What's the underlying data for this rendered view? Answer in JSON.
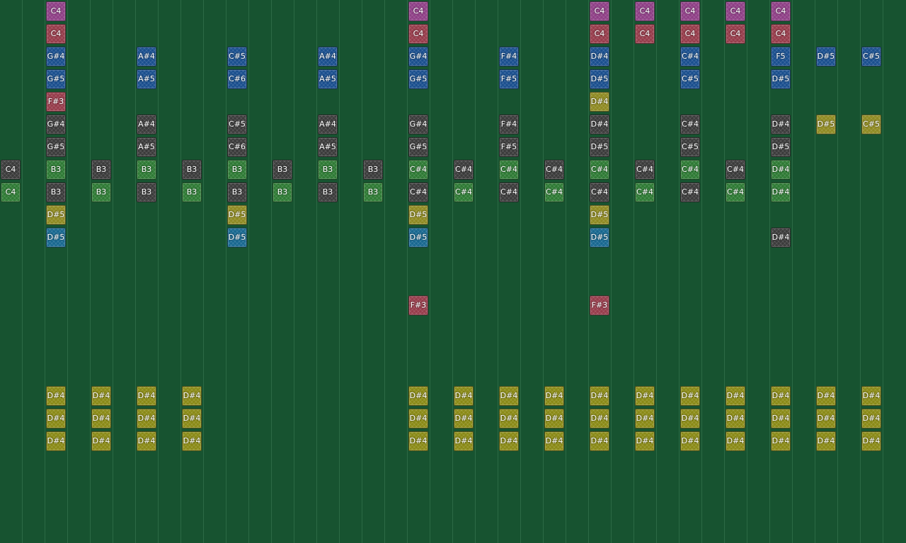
{
  "colors": {
    "background": "#175330",
    "gridline": "#2c6a45",
    "purple": "#8e3f86",
    "red": "#963c4b",
    "blue": "#1a4f8e",
    "gray": "#3b3b3b",
    "green": "#2e7a34",
    "olive": "#8f8a22",
    "yellow": "#8a8a16",
    "teal": "#186890"
  },
  "columns": [
    [
      {
        "row": 7,
        "label": "C4",
        "color": "gray"
      },
      {
        "row": 8,
        "label": "C4",
        "color": "green"
      }
    ],
    [
      {
        "row": 0,
        "label": "C4",
        "color": "purple"
      },
      {
        "row": 1,
        "label": "C4",
        "color": "red"
      },
      {
        "row": 2,
        "label": "G#4",
        "color": "blue"
      },
      {
        "row": 3,
        "label": "G#5",
        "color": "blue"
      },
      {
        "row": 4,
        "label": "F#3",
        "color": "red"
      },
      {
        "row": 5,
        "label": "G#4",
        "color": "gray"
      },
      {
        "row": 6,
        "label": "G#5",
        "color": "gray"
      },
      {
        "row": 7,
        "label": "B3",
        "color": "green"
      },
      {
        "row": 8,
        "label": "B3",
        "color": "gray"
      },
      {
        "row": 9,
        "label": "D#5",
        "color": "olive"
      },
      {
        "row": 10,
        "label": "D#5",
        "color": "teal"
      },
      {
        "row": 17,
        "label": "D#4",
        "color": "yellow"
      },
      {
        "row": 18,
        "label": "D#4",
        "color": "yellow"
      },
      {
        "row": 19,
        "label": "D#4",
        "color": "yellow"
      }
    ],
    [
      {
        "row": 7,
        "label": "B3",
        "color": "gray"
      },
      {
        "row": 8,
        "label": "B3",
        "color": "green"
      },
      {
        "row": 17,
        "label": "D#4",
        "color": "yellow"
      },
      {
        "row": 18,
        "label": "D#4",
        "color": "yellow"
      },
      {
        "row": 19,
        "label": "D#4",
        "color": "yellow"
      }
    ],
    [
      {
        "row": 2,
        "label": "A#4",
        "color": "blue"
      },
      {
        "row": 3,
        "label": "A#5",
        "color": "blue"
      },
      {
        "row": 5,
        "label": "A#4",
        "color": "gray"
      },
      {
        "row": 6,
        "label": "A#5",
        "color": "gray"
      },
      {
        "row": 7,
        "label": "B3",
        "color": "green"
      },
      {
        "row": 8,
        "label": "B3",
        "color": "gray"
      },
      {
        "row": 17,
        "label": "D#4",
        "color": "yellow"
      },
      {
        "row": 18,
        "label": "D#4",
        "color": "yellow"
      },
      {
        "row": 19,
        "label": "D#4",
        "color": "yellow"
      }
    ],
    [
      {
        "row": 7,
        "label": "B3",
        "color": "gray"
      },
      {
        "row": 8,
        "label": "B3",
        "color": "green"
      },
      {
        "row": 17,
        "label": "D#4",
        "color": "yellow"
      },
      {
        "row": 18,
        "label": "D#4",
        "color": "yellow"
      },
      {
        "row": 19,
        "label": "D#4",
        "color": "yellow"
      }
    ],
    [
      {
        "row": 2,
        "label": "C#5",
        "color": "blue"
      },
      {
        "row": 3,
        "label": "C#6",
        "color": "blue"
      },
      {
        "row": 5,
        "label": "C#5",
        "color": "gray"
      },
      {
        "row": 6,
        "label": "C#6",
        "color": "gray"
      },
      {
        "row": 7,
        "label": "B3",
        "color": "green"
      },
      {
        "row": 8,
        "label": "B3",
        "color": "gray"
      },
      {
        "row": 9,
        "label": "D#5",
        "color": "olive"
      },
      {
        "row": 10,
        "label": "D#5",
        "color": "teal"
      }
    ],
    [
      {
        "row": 7,
        "label": "B3",
        "color": "gray"
      },
      {
        "row": 8,
        "label": "B3",
        "color": "green"
      }
    ],
    [
      {
        "row": 2,
        "label": "A#4",
        "color": "blue"
      },
      {
        "row": 3,
        "label": "A#5",
        "color": "blue"
      },
      {
        "row": 5,
        "label": "A#4",
        "color": "gray"
      },
      {
        "row": 6,
        "label": "A#5",
        "color": "gray"
      },
      {
        "row": 7,
        "label": "B3",
        "color": "green"
      },
      {
        "row": 8,
        "label": "B3",
        "color": "gray"
      }
    ],
    [
      {
        "row": 7,
        "label": "B3",
        "color": "gray"
      },
      {
        "row": 8,
        "label": "B3",
        "color": "green"
      }
    ],
    [
      {
        "row": 0,
        "label": "C4",
        "color": "purple"
      },
      {
        "row": 1,
        "label": "C4",
        "color": "red"
      },
      {
        "row": 2,
        "label": "G#4",
        "color": "blue"
      },
      {
        "row": 3,
        "label": "G#5",
        "color": "blue"
      },
      {
        "row": 5,
        "label": "G#4",
        "color": "gray"
      },
      {
        "row": 6,
        "label": "G#5",
        "color": "gray"
      },
      {
        "row": 7,
        "label": "C#4",
        "color": "green"
      },
      {
        "row": 8,
        "label": "C#4",
        "color": "gray"
      },
      {
        "row": 9,
        "label": "D#5",
        "color": "olive"
      },
      {
        "row": 10,
        "label": "D#5",
        "color": "teal"
      },
      {
        "row": 13,
        "label": "F#3",
        "color": "red"
      },
      {
        "row": 17,
        "label": "D#4",
        "color": "yellow"
      },
      {
        "row": 18,
        "label": "D#4",
        "color": "yellow"
      },
      {
        "row": 19,
        "label": "D#4",
        "color": "yellow"
      }
    ],
    [
      {
        "row": 7,
        "label": "C#4",
        "color": "gray"
      },
      {
        "row": 8,
        "label": "C#4",
        "color": "green"
      },
      {
        "row": 17,
        "label": "D#4",
        "color": "yellow"
      },
      {
        "row": 18,
        "label": "D#4",
        "color": "yellow"
      },
      {
        "row": 19,
        "label": "D#4",
        "color": "yellow"
      }
    ],
    [
      {
        "row": 2,
        "label": "F#4",
        "color": "blue"
      },
      {
        "row": 3,
        "label": "F#5",
        "color": "blue"
      },
      {
        "row": 5,
        "label": "F#4",
        "color": "gray"
      },
      {
        "row": 6,
        "label": "F#5",
        "color": "gray"
      },
      {
        "row": 7,
        "label": "C#4",
        "color": "green"
      },
      {
        "row": 8,
        "label": "C#4",
        "color": "gray"
      },
      {
        "row": 17,
        "label": "D#4",
        "color": "yellow"
      },
      {
        "row": 18,
        "label": "D#4",
        "color": "yellow"
      },
      {
        "row": 19,
        "label": "D#4",
        "color": "yellow"
      }
    ],
    [
      {
        "row": 7,
        "label": "C#4",
        "color": "gray"
      },
      {
        "row": 8,
        "label": "C#4",
        "color": "green"
      },
      {
        "row": 17,
        "label": "D#4",
        "color": "yellow"
      },
      {
        "row": 18,
        "label": "D#4",
        "color": "yellow"
      },
      {
        "row": 19,
        "label": "D#4",
        "color": "yellow"
      }
    ],
    [
      {
        "row": 0,
        "label": "C4",
        "color": "purple"
      },
      {
        "row": 1,
        "label": "C4",
        "color": "red"
      },
      {
        "row": 2,
        "label": "D#4",
        "color": "blue"
      },
      {
        "row": 3,
        "label": "D#5",
        "color": "blue"
      },
      {
        "row": 4,
        "label": "D#4",
        "color": "olive"
      },
      {
        "row": 5,
        "label": "D#4",
        "color": "gray"
      },
      {
        "row": 6,
        "label": "D#5",
        "color": "gray"
      },
      {
        "row": 7,
        "label": "C#4",
        "color": "green"
      },
      {
        "row": 8,
        "label": "C#4",
        "color": "gray"
      },
      {
        "row": 9,
        "label": "D#5",
        "color": "olive"
      },
      {
        "row": 10,
        "label": "D#5",
        "color": "teal"
      },
      {
        "row": 13,
        "label": "F#3",
        "color": "red"
      },
      {
        "row": 17,
        "label": "D#4",
        "color": "yellow"
      },
      {
        "row": 18,
        "label": "D#4",
        "color": "yellow"
      },
      {
        "row": 19,
        "label": "D#4",
        "color": "yellow"
      }
    ],
    [
      {
        "row": 0,
        "label": "C4",
        "color": "purple"
      },
      {
        "row": 1,
        "label": "C4",
        "color": "red"
      },
      {
        "row": 7,
        "label": "C#4",
        "color": "gray"
      },
      {
        "row": 8,
        "label": "C#4",
        "color": "green"
      },
      {
        "row": 17,
        "label": "D#4",
        "color": "yellow"
      },
      {
        "row": 18,
        "label": "D#4",
        "color": "yellow"
      },
      {
        "row": 19,
        "label": "D#4",
        "color": "yellow"
      }
    ],
    [
      {
        "row": 0,
        "label": "C4",
        "color": "purple"
      },
      {
        "row": 1,
        "label": "C4",
        "color": "red"
      },
      {
        "row": 2,
        "label": "C#4",
        "color": "blue"
      },
      {
        "row": 3,
        "label": "C#5",
        "color": "blue"
      },
      {
        "row": 5,
        "label": "C#4",
        "color": "gray"
      },
      {
        "row": 6,
        "label": "C#5",
        "color": "gray"
      },
      {
        "row": 7,
        "label": "C#4",
        "color": "green"
      },
      {
        "row": 8,
        "label": "C#4",
        "color": "gray"
      },
      {
        "row": 17,
        "label": "D#4",
        "color": "yellow"
      },
      {
        "row": 18,
        "label": "D#4",
        "color": "yellow"
      },
      {
        "row": 19,
        "label": "D#4",
        "color": "yellow"
      }
    ],
    [
      {
        "row": 0,
        "label": "C4",
        "color": "purple"
      },
      {
        "row": 1,
        "label": "C4",
        "color": "red"
      },
      {
        "row": 7,
        "label": "C#4",
        "color": "gray"
      },
      {
        "row": 8,
        "label": "C#4",
        "color": "green"
      },
      {
        "row": 17,
        "label": "D#4",
        "color": "yellow"
      },
      {
        "row": 18,
        "label": "D#4",
        "color": "yellow"
      },
      {
        "row": 19,
        "label": "D#4",
        "color": "yellow"
      }
    ],
    [
      {
        "row": 0,
        "label": "C4",
        "color": "purple"
      },
      {
        "row": 1,
        "label": "C4",
        "color": "red"
      },
      {
        "row": 2,
        "label": "F5",
        "color": "blue"
      },
      {
        "row": 3,
        "label": "D#5",
        "color": "blue"
      },
      {
        "row": 5,
        "label": "D#4",
        "color": "gray"
      },
      {
        "row": 6,
        "label": "D#5",
        "color": "gray"
      },
      {
        "row": 7,
        "label": "D#4",
        "color": "green"
      },
      {
        "row": 8,
        "label": "D#4",
        "color": "green"
      },
      {
        "row": 10,
        "label": "D#4",
        "color": "gray"
      },
      {
        "row": 17,
        "label": "D#4",
        "color": "yellow"
      },
      {
        "row": 18,
        "label": "D#4",
        "color": "yellow"
      },
      {
        "row": 19,
        "label": "D#4",
        "color": "yellow"
      }
    ],
    [
      {
        "row": 2,
        "label": "D#5",
        "color": "blue"
      },
      {
        "row": 5,
        "label": "D#5",
        "color": "olive"
      },
      {
        "row": 17,
        "label": "D#4",
        "color": "yellow"
      },
      {
        "row": 18,
        "label": "D#4",
        "color": "yellow"
      },
      {
        "row": 19,
        "label": "D#4",
        "color": "yellow"
      }
    ],
    [
      {
        "row": 2,
        "label": "C#5",
        "color": "blue"
      },
      {
        "row": 5,
        "label": "C#5",
        "color": "olive"
      },
      {
        "row": 17,
        "label": "D#4",
        "color": "yellow"
      },
      {
        "row": 18,
        "label": "D#4",
        "color": "yellow"
      },
      {
        "row": 19,
        "label": "D#4",
        "color": "yellow"
      }
    ]
  ]
}
